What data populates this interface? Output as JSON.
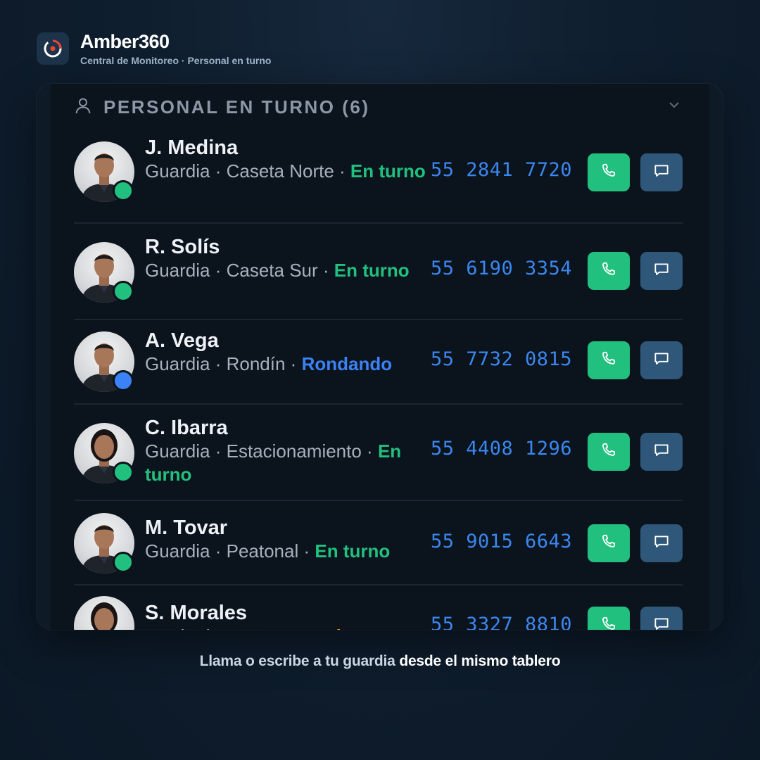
{
  "app": {
    "title": "Amber360",
    "subtitle": "Central de Monitoreo · Personal en turno"
  },
  "section": {
    "title": "PERSONAL EN TURNO (6)"
  },
  "colors": {
    "on_duty": "#22c07e",
    "patrolling": "#3b82f6",
    "control": "#f0a020",
    "phone": "#3b87f0",
    "call_button": "#22c07e",
    "message_button": "#2f5779"
  },
  "staff": [
    {
      "name": "J. Medina",
      "role": "Guardia",
      "location": "Caseta Norte",
      "status": "En turno",
      "status_kind": "on_duty",
      "phone": "55 2841 7720"
    },
    {
      "name": "R. Solís",
      "role": "Guardia",
      "location": "Caseta Sur",
      "status": "En turno",
      "status_kind": "on_duty",
      "phone": "55 6190 3354"
    },
    {
      "name": "A. Vega",
      "role": "Guardia",
      "location": "Rondín",
      "status": "Rondando",
      "status_kind": "patrolling",
      "phone": "55 7732 0815"
    },
    {
      "name": "C. Ibarra",
      "role": "Guardia",
      "location": "Estacionamiento",
      "status": "En turno",
      "status_kind": "on_duty",
      "phone": "55 4408 1296"
    },
    {
      "name": "M. Tovar",
      "role": "Guardia",
      "location": "Peatonal",
      "status": "En turno",
      "status_kind": "on_duty",
      "phone": "55 9015 6643"
    },
    {
      "name": "S. Morales",
      "role": "Monitorista",
      "location": "",
      "status": "En control",
      "status_kind": "control",
      "phone": "55 3327 8810"
    }
  ],
  "caption": {
    "lead": "Llama o escribe a tu guardia ",
    "emphasis": "desde el mismo tablero"
  }
}
